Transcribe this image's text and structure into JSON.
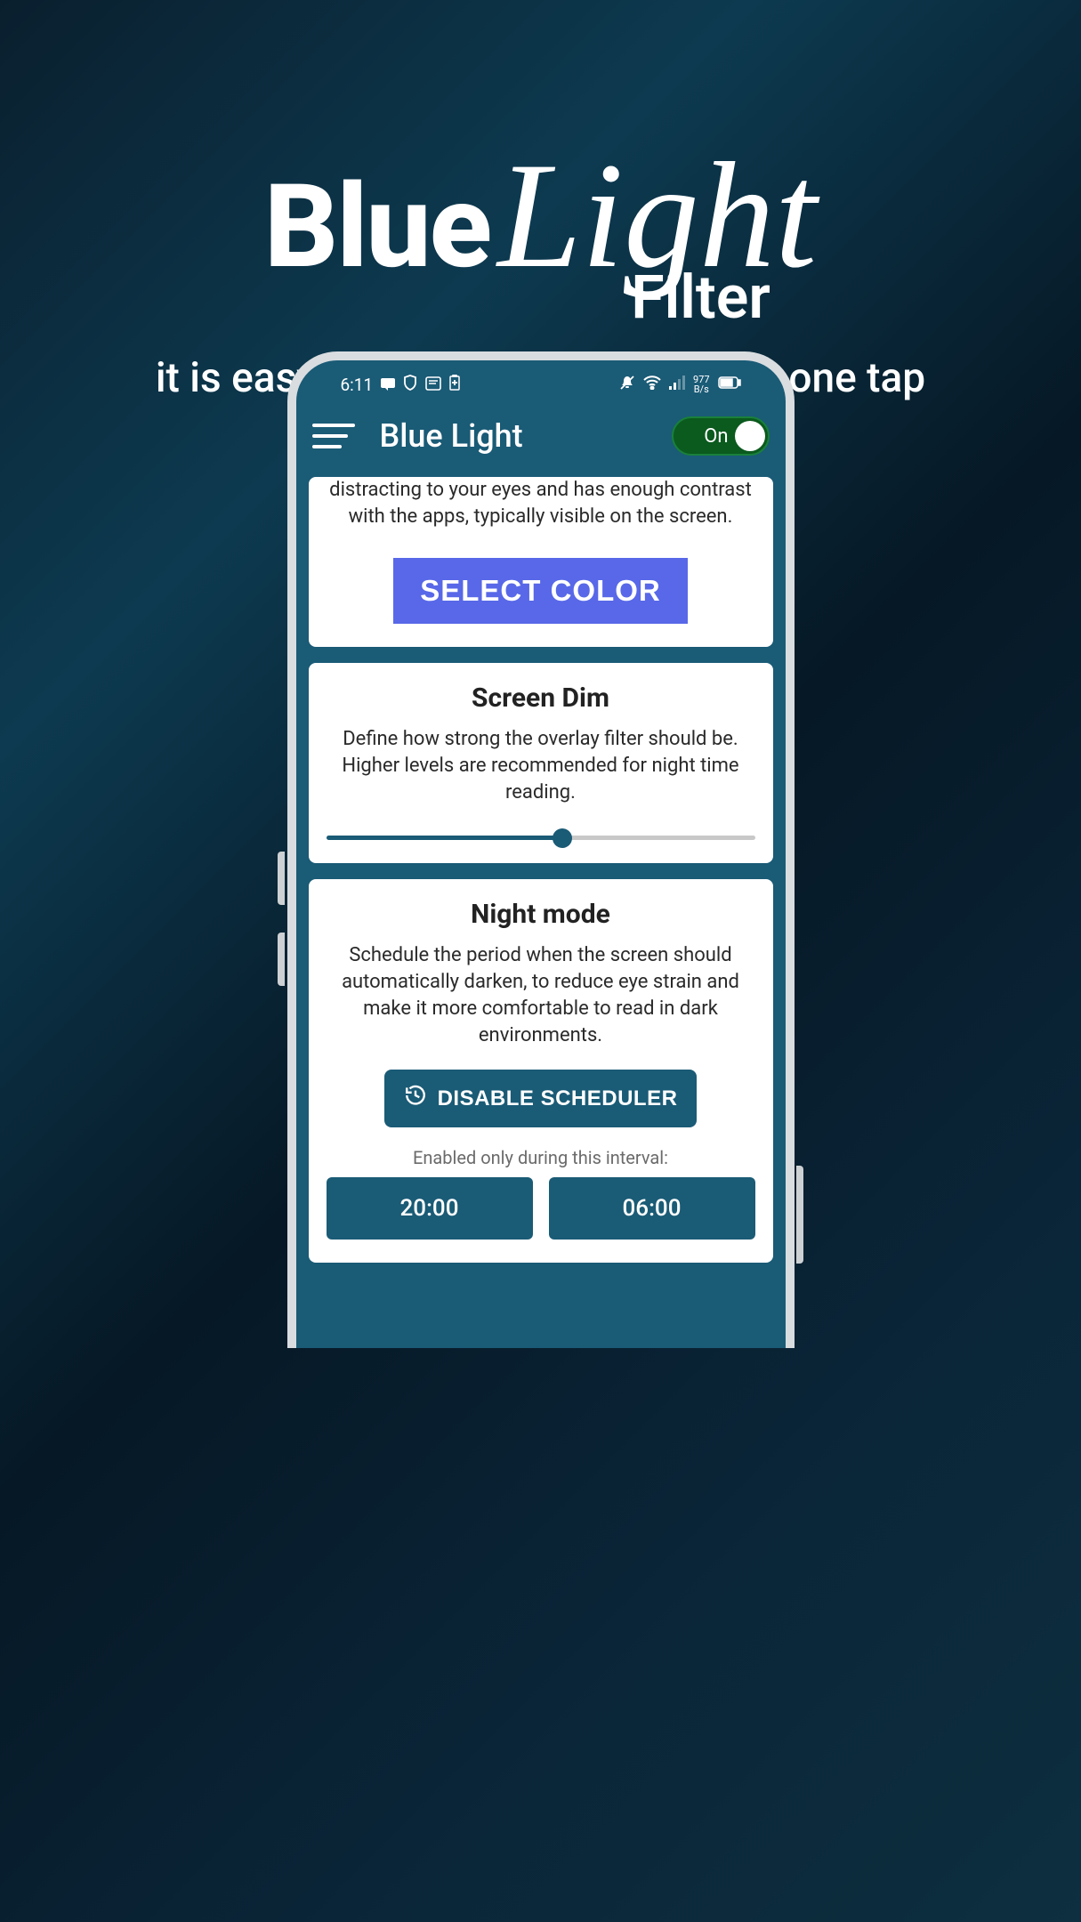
{
  "promo": {
    "blue": "Blue",
    "light": "Light",
    "filter": "Filter",
    "tagline": "it is easy to turn on or off with just one tap"
  },
  "status": {
    "time": "6:11",
    "speed_num": "977",
    "speed_unit": "B/s"
  },
  "app": {
    "title": "Blue Light",
    "toggle_label": "On"
  },
  "color_card": {
    "desc": "distracting to your eyes and has enough contrast with the apps, typically visible on the screen.",
    "button": "SELECT COLOR"
  },
  "dim_card": {
    "title": "Screen Dim",
    "desc": "Define how strong the overlay filter should be. Higher levels are recommended for night time reading."
  },
  "night_card": {
    "title": "Night mode",
    "desc": "Schedule the period when the screen should automatically darken, to reduce eye strain and make it more comfortable to read in dark environments.",
    "button": "DISABLE SCHEDULER",
    "interval_label": "Enabled only during this interval:",
    "start": "20:00",
    "end": "06:00"
  }
}
